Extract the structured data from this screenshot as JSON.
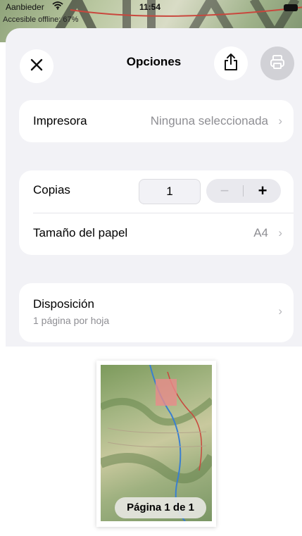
{
  "status_bar": {
    "carrier": "Aanbieder",
    "time": "11:54",
    "offline_text": "Accesible offline: 67%"
  },
  "header": {
    "title": "Opciones"
  },
  "printer": {
    "label": "Impresora",
    "value": "Ninguna seleccionada"
  },
  "copies": {
    "label": "Copias",
    "value": "1",
    "minus": "−",
    "plus": "+"
  },
  "paper_size": {
    "label": "Tamaño del papel",
    "value": "A4"
  },
  "layout": {
    "label": "Disposición",
    "subtitle": "1 página por hoja"
  },
  "preview": {
    "page_label": "Página 1 de 1"
  },
  "icons": {
    "close": "close-icon",
    "share": "share-icon",
    "print": "printer-icon",
    "chevron": "chevron-right-icon"
  },
  "colors": {
    "sheet_background": "#f2f2f6",
    "secondary_text": "#8e8e93",
    "disabled_button": "#d1d1d6"
  }
}
